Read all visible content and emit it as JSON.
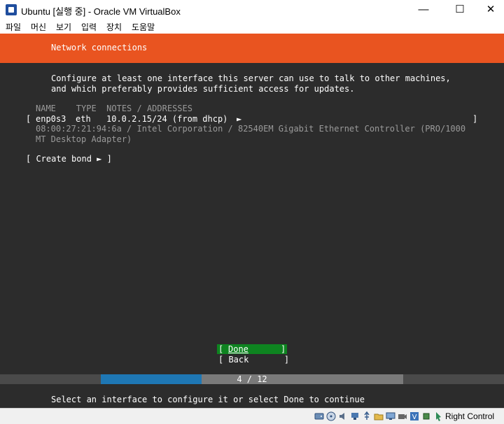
{
  "window": {
    "title": "Ubuntu [실행 중] - Oracle VM VirtualBox",
    "minimize": "—",
    "maximize": "☐",
    "close": "✕"
  },
  "menu": [
    "파일",
    "머신",
    "보기",
    "입력",
    "장치",
    "도움말"
  ],
  "screen": {
    "header_title": "Network connections",
    "description": [
      "Configure at least one interface this server can use to talk to other machines,",
      "and which preferably provides sufficient access for updates."
    ],
    "table_header": "NAME    TYPE  NOTES / ADDRESSES",
    "interface": {
      "open_bracket": "[",
      "name": "enp0s3",
      "type": "eth",
      "address": "10.0.2.15/24 (from dhcp)",
      "arrow": "►",
      "close_bracket": "]",
      "detail_line1": "08:00:27:21:94:6a / Intel Corporation / 82540EM Gigabit Ethernet Controller (PRO/1000",
      "detail_line2": "MT Desktop Adapter)"
    },
    "create_bond": "[ Create bond ► ]",
    "buttons": {
      "done_open": "[",
      "done_label": "Done",
      "done_close": "]",
      "back": "[ Back       ]"
    },
    "progress": {
      "text": "4 / 12",
      "value": 4,
      "total": 12
    },
    "status_message": "Select an interface to configure it or select Done to continue"
  },
  "statusbar": {
    "host_key": "Right Control",
    "icons": [
      "hard-disk-icon",
      "optical-drive-icon",
      "audio-icon",
      "network-icon",
      "usb-icon",
      "shared-folder-icon",
      "display-icon",
      "recording-icon",
      "virtualization-icon",
      "cpu-icon",
      "mouse-integration-icon",
      "host-key-icon"
    ]
  },
  "colors": {
    "header": "#e95420",
    "terminal_bg": "#2c2c2c",
    "done_button": "#0e8420",
    "progress_fill": "#1e77b4"
  }
}
